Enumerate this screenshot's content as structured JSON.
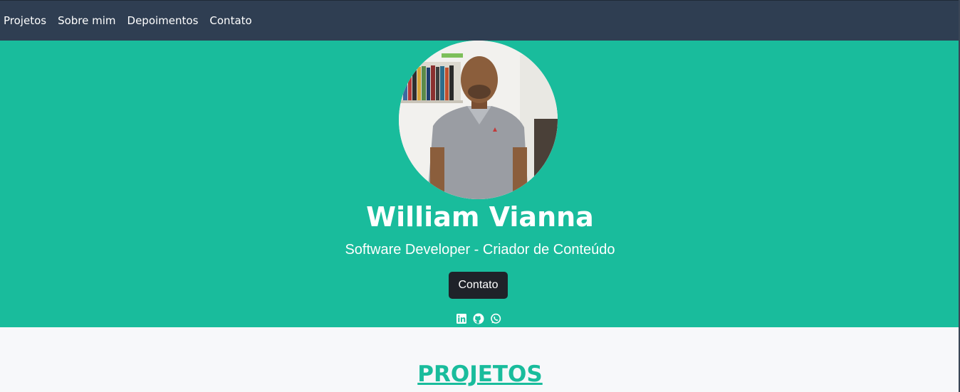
{
  "nav": {
    "items": [
      "Projetos",
      "Sobre mim",
      "Depoimentos",
      "Contato"
    ]
  },
  "hero": {
    "name": "William Vianna",
    "subtitle": "Software Developer - Criador de Conteúdo",
    "button_label": "Contato",
    "social_icons": [
      "linkedin-icon",
      "github-icon",
      "whatsapp-icon"
    ]
  },
  "sections": {
    "projects_title": "PROJETOS"
  },
  "colors": {
    "navbar": "#2f3e52",
    "hero": "#19bc9c",
    "button": "#1f2229",
    "accent": "#19bc9c",
    "page_bg": "#f7f8fa"
  }
}
